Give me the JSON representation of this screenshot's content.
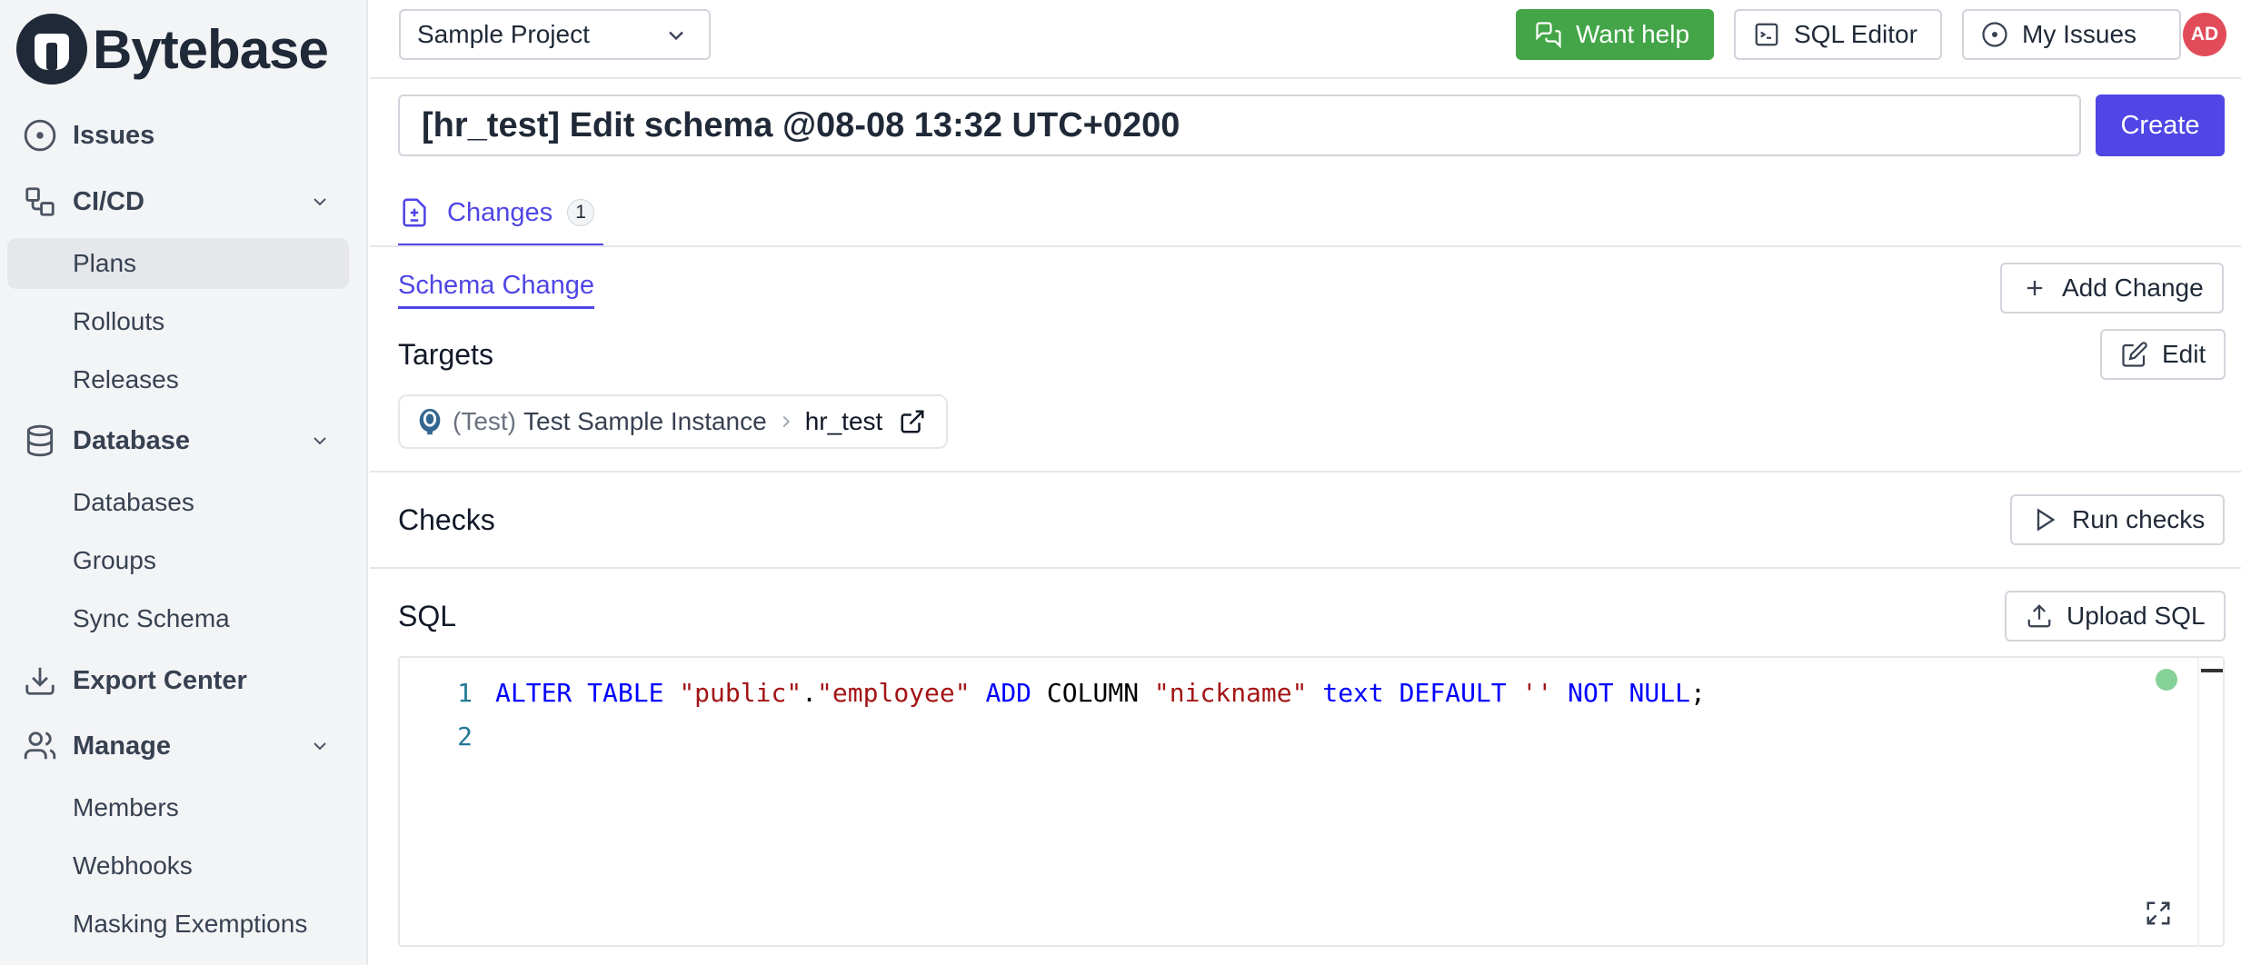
{
  "app": {
    "name": "Bytebase"
  },
  "sidebar": {
    "issues": "Issues",
    "cicd": {
      "label": "CI/CD",
      "items": [
        "Plans",
        "Rollouts",
        "Releases"
      ]
    },
    "database": {
      "label": "Database",
      "items": [
        "Databases",
        "Groups",
        "Sync Schema"
      ]
    },
    "export_center": "Export Center",
    "manage": {
      "label": "Manage",
      "items": [
        "Members",
        "Webhooks",
        "Masking Exemptions"
      ]
    }
  },
  "header": {
    "project": "Sample Project",
    "want_help": "Want help",
    "sql_editor": "SQL Editor",
    "my_issues": "My Issues",
    "avatar": "AD"
  },
  "plan": {
    "title": "[hr_test] Edit schema @08-08 13:32 UTC+0200",
    "create": "Create"
  },
  "tabs": {
    "changes": "Changes",
    "changes_count": "1"
  },
  "spec": {
    "subtab": "Schema Change",
    "add_change": "Add Change",
    "targets_title": "Targets",
    "edit": "Edit",
    "target": {
      "environment": "(Test)",
      "instance": "Test Sample Instance",
      "database": "hr_test"
    },
    "checks_title": "Checks",
    "run_checks": "Run checks",
    "sql_title": "SQL",
    "upload_sql": "Upload SQL"
  },
  "editor": {
    "line_numbers": [
      "1",
      "2"
    ],
    "tokens": [
      {
        "t": "ALTER",
        "c": "kw"
      },
      {
        "t": " ",
        "c": "plain"
      },
      {
        "t": "TABLE",
        "c": "kw"
      },
      {
        "t": " ",
        "c": "plain"
      },
      {
        "t": "\"public\"",
        "c": "str"
      },
      {
        "t": ".",
        "c": "plain"
      },
      {
        "t": "\"employee\"",
        "c": "str"
      },
      {
        "t": " ",
        "c": "plain"
      },
      {
        "t": "ADD",
        "c": "kw"
      },
      {
        "t": " COLUMN ",
        "c": "plain"
      },
      {
        "t": "\"nickname\"",
        "c": "str"
      },
      {
        "t": " ",
        "c": "plain"
      },
      {
        "t": "text",
        "c": "kw"
      },
      {
        "t": " ",
        "c": "plain"
      },
      {
        "t": "DEFAULT",
        "c": "kw"
      },
      {
        "t": " ",
        "c": "plain"
      },
      {
        "t": "''",
        "c": "str"
      },
      {
        "t": " ",
        "c": "plain"
      },
      {
        "t": "NOT",
        "c": "kw"
      },
      {
        "t": " ",
        "c": "plain"
      },
      {
        "t": "NULL",
        "c": "kw"
      },
      {
        "t": ";",
        "c": "plain"
      }
    ]
  },
  "colors": {
    "accent": "#4f46e5",
    "help_green": "#43a547",
    "avatar": "#e24c5a"
  }
}
